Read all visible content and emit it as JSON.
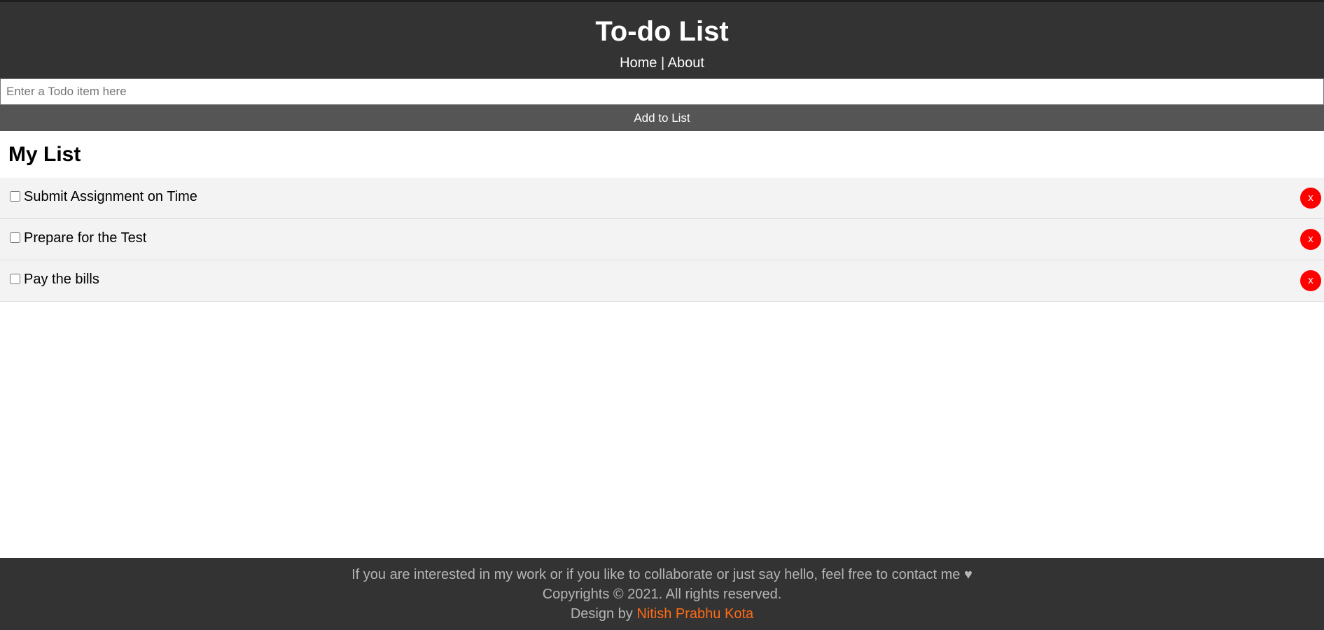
{
  "header": {
    "title": "To-do List",
    "nav": {
      "home": "Home",
      "separator": "|",
      "about": "About"
    }
  },
  "form": {
    "input_placeholder": "Enter a Todo item here",
    "input_value": "",
    "add_button_label": "Add to List"
  },
  "list": {
    "title": "My List",
    "items": [
      {
        "text": "Submit Assignment on Time",
        "checked": false,
        "delete_label": "x"
      },
      {
        "text": "Prepare for the Test",
        "checked": false,
        "delete_label": "x"
      },
      {
        "text": "Pay the bills",
        "checked": false,
        "delete_label": "x"
      }
    ]
  },
  "footer": {
    "contact_line": "If you are interested in my work or if you like to collaborate or just say hello, feel free to contact me ♥",
    "copyright_line": "Copyrights © 2021. All rights reserved.",
    "design_by_label": "Design by",
    "author_name": "Nitish Prabhu Kota"
  },
  "colors": {
    "header_bg": "#333333",
    "add_button_bg": "#555555",
    "list_item_bg": "#f3f3f3",
    "delete_button_bg": "#ff0000",
    "footer_bg": "#333333",
    "footer_text": "#b5b5b5",
    "author_link": "#ff6a13"
  }
}
